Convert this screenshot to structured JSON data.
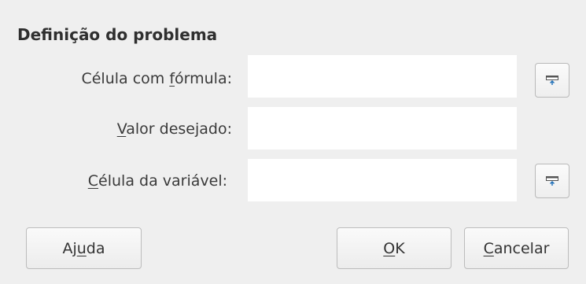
{
  "section": {
    "title": "Definição do problema"
  },
  "fields": {
    "formula_cell": {
      "label_pre": "Célula com ",
      "label_key": "f",
      "label_post": "órmula:",
      "value": ""
    },
    "target_value": {
      "label_pre": "",
      "label_key": "V",
      "label_post": "alor desejado:",
      "value": ""
    },
    "variable_cell": {
      "label_pre": "",
      "label_key": "C",
      "label_post": "élula da variável:",
      "value": ""
    }
  },
  "buttons": {
    "help": {
      "pre": "Aj",
      "key": "u",
      "post": "da"
    },
    "ok": {
      "pre": "",
      "key": "O",
      "post": "K"
    },
    "cancel": {
      "pre": "",
      "key": "C",
      "post": "ancelar"
    }
  },
  "icons": {
    "shrink": "shrink-icon"
  },
  "colors": {
    "dialog_bg": "#efefef",
    "field_bg": "#ffffff",
    "button_border": "#bcbcbc",
    "icon_accent": "#1e6fb8"
  }
}
